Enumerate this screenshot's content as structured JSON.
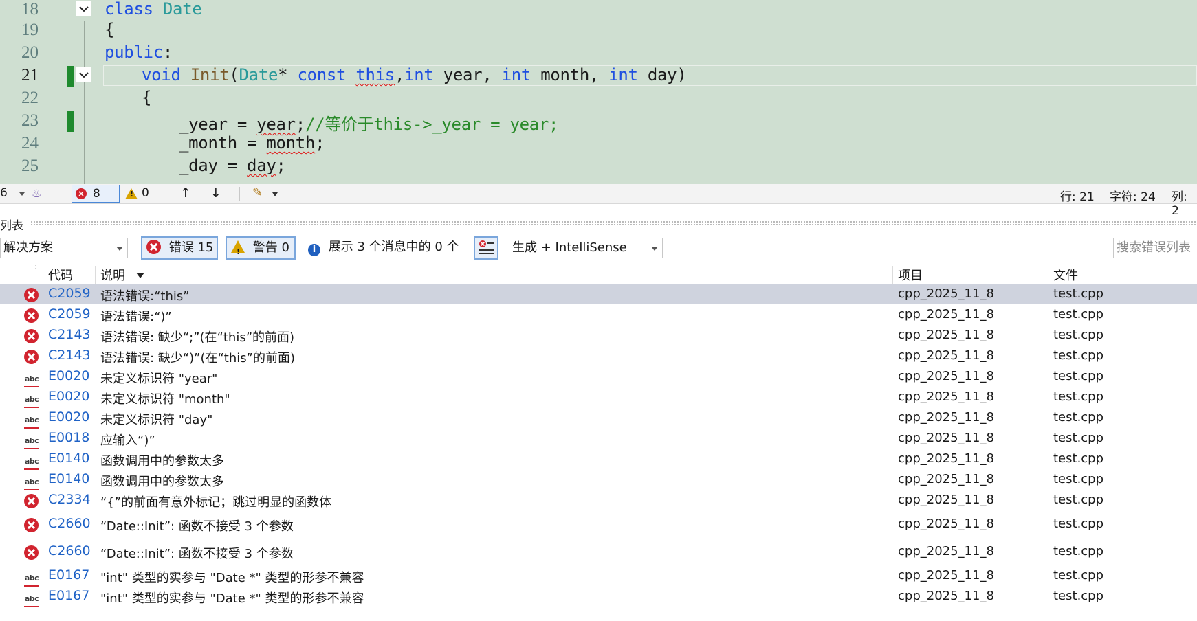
{
  "editor": {
    "lines": [
      {
        "num": "18"
      },
      {
        "num": "19"
      },
      {
        "num": "20"
      },
      {
        "num": "21"
      },
      {
        "num": "22"
      },
      {
        "num": "23"
      },
      {
        "num": "24"
      },
      {
        "num": "25"
      }
    ],
    "code": {
      "l18_kw": "class",
      "l18_type": "Date",
      "l19_text": "{",
      "l20_kw": "public",
      "l20_colon": ":",
      "l21_void": "void",
      "l21_fn": "Init",
      "l21_paren": "(",
      "l21_type": "Date",
      "l21_star": "* ",
      "l21_const": "const",
      "l21_this": "this",
      "l21_comma": ",",
      "l21_int1": "int",
      "l21_year": " year, ",
      "l21_int2": "int",
      "l21_month": " month, ",
      "l21_int3": "int",
      "l21_day": " day)",
      "l22_text": "{",
      "l23_lhs": "_year = ",
      "l23_rhs": "year",
      "l23_semi": ";",
      "l23_comment": "//等价于this->_year = year;",
      "l24_lhs": "_month = ",
      "l24_rhs": "month",
      "l24_semi": ";",
      "l25_lhs": "_day = ",
      "l25_rhs": "day",
      "l25_semi": ";"
    }
  },
  "statusbar": {
    "zoom_fragment": "6",
    "error_count": "8",
    "warning_count": "0",
    "up_arrow": "↑",
    "down_arrow": "↓",
    "line": "行: 21",
    "char": "字符: 24",
    "col": "列: 2"
  },
  "panel": {
    "title": "列表",
    "scope_combo": "解决方案",
    "errors_btn": "错误 15",
    "warnings_btn": "警告 0",
    "messages_btn": "展示 3 个消息中的 0 个",
    "source_combo": "生成 + IntelliSense",
    "search_placeholder": "搜索错误列表"
  },
  "table": {
    "headers": {
      "code": "代码",
      "desc": "说明",
      "project": "项目",
      "file": "文件"
    },
    "rows": [
      {
        "icon": "error",
        "code": "C2059",
        "desc": "语法错误:“this”",
        "project": "cpp_2025_11_8",
        "file": "test.cpp"
      },
      {
        "icon": "error",
        "code": "C2059",
        "desc": "语法错误:“)”",
        "project": "cpp_2025_11_8",
        "file": "test.cpp"
      },
      {
        "icon": "error",
        "code": "C2143",
        "desc": "语法错误: 缺少“;”(在“this”的前面)",
        "project": "cpp_2025_11_8",
        "file": "test.cpp"
      },
      {
        "icon": "error",
        "code": "C2143",
        "desc": "语法错误: 缺少“)”(在“this”的前面)",
        "project": "cpp_2025_11_8",
        "file": "test.cpp"
      },
      {
        "icon": "abc",
        "code": "E0020",
        "desc": "未定义标识符 \"year\"",
        "project": "cpp_2025_11_8",
        "file": "test.cpp"
      },
      {
        "icon": "abc",
        "code": "E0020",
        "desc": "未定义标识符 \"month\"",
        "project": "cpp_2025_11_8",
        "file": "test.cpp"
      },
      {
        "icon": "abc",
        "code": "E0020",
        "desc": "未定义标识符 \"day\"",
        "project": "cpp_2025_11_8",
        "file": "test.cpp"
      },
      {
        "icon": "abc",
        "code": "E0018",
        "desc": "应输入“)”",
        "project": "cpp_2025_11_8",
        "file": "test.cpp"
      },
      {
        "icon": "abc",
        "code": "E0140",
        "desc": "函数调用中的参数太多",
        "project": "cpp_2025_11_8",
        "file": "test.cpp"
      },
      {
        "icon": "abc",
        "code": "E0140",
        "desc": "函数调用中的参数太多",
        "project": "cpp_2025_11_8",
        "file": "test.cpp"
      },
      {
        "icon": "error",
        "code": "C2334",
        "desc": "“{”的前面有意外标记；跳过明显的函数体",
        "project": "cpp_2025_11_8",
        "file": "test.cpp"
      },
      {
        "icon": "error",
        "code": "C2660",
        "desc": "“Date::Init”: 函数不接受 3 个参数",
        "project": "cpp_2025_11_8",
        "file": "test.cpp"
      },
      {
        "icon": "error",
        "code": "C2660",
        "desc": "“Date::Init”: 函数不接受 3 个参数",
        "project": "cpp_2025_11_8",
        "file": "test.cpp"
      },
      {
        "icon": "abc",
        "code": "E0167",
        "desc": "\"int\" 类型的实参与 \"Date *\" 类型的形参不兼容",
        "project": "cpp_2025_11_8",
        "file": "test.cpp"
      },
      {
        "icon": "abc",
        "code": "E0167",
        "desc": "\"int\" 类型的实参与 \"Date *\" 类型的形参不兼容",
        "project": "cpp_2025_11_8",
        "file": "test.cpp"
      }
    ]
  },
  "colors": {
    "editor_bg": "#cfdfd1",
    "keyword": "#1f4fe0",
    "type": "#2a9a9a",
    "comment": "#2a8a2a",
    "error_red": "#d1242f",
    "code_link": "#1f62c6",
    "selected_row": "#cfd3de"
  }
}
